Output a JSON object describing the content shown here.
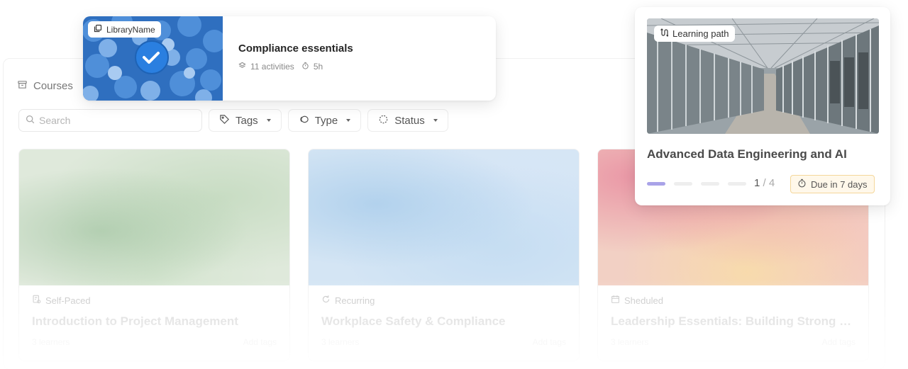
{
  "courses_section": {
    "title": "Courses",
    "search_placeholder": "Search",
    "filters": [
      "Tags",
      "Type",
      "Status"
    ],
    "cards": [
      {
        "type": "Self-Paced",
        "title": "Introduction to Project Management",
        "learners": "3 learners",
        "due": "Add tags"
      },
      {
        "type": "Recurring",
        "title": "Workplace Safety & Compliance",
        "learners": "3 learners",
        "due": "Add tags"
      },
      {
        "type": "Sheduled",
        "title": "Leadership Essentials: Building Strong Te…",
        "learners": "3 learners",
        "due": "Add tags"
      }
    ]
  },
  "library_card": {
    "badge": "LibraryName",
    "title": "Compliance essentials",
    "activities": "11 activities",
    "duration": "5h"
  },
  "path_card": {
    "badge": "Learning path",
    "title": "Advanced Data Engineering and AI",
    "progress_completed": 1,
    "progress_total": 4,
    "progress_current": "1",
    "progress_total_label": "/ 4",
    "due": "Due in 7 days",
    "accent_color": "#a9a3e8",
    "due_border_color": "#f4d79b"
  }
}
